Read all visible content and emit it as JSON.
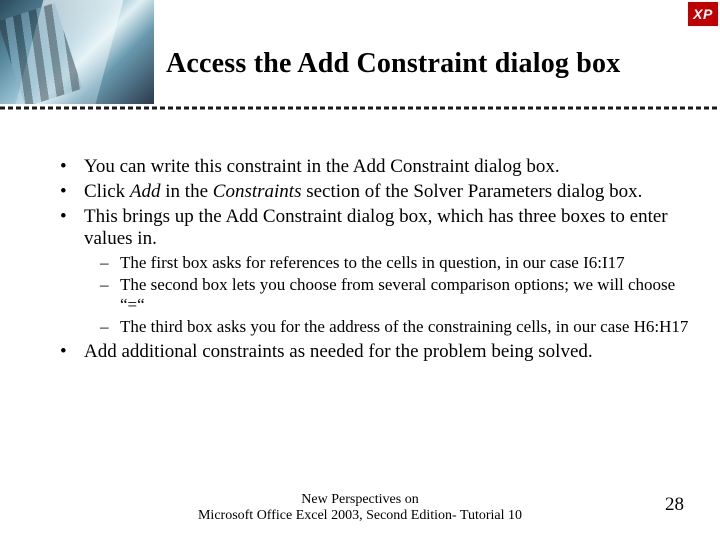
{
  "badge": "XP",
  "title": "Access the Add Constraint dialog box",
  "bullets": {
    "b1_a": "You can write this constraint in the Add Constraint dialog box.",
    "b2_a": "Click ",
    "b2_i": "Add",
    "b2_b": " in the ",
    "b2_j": "Constraints",
    "b2_c": " section of the Solver Parameters dialog box.",
    "b3_a": "This brings up the Add Constraint dialog box, which has three boxes to enter values in.",
    "s1": "The first box asks for references to the cells in question, in our case I6:I17",
    "s2": "The second box lets you choose from several comparison options; we will choose “=“",
    "s3": "The third box asks you for the address of the constraining cells, in our case H6:H17",
    "b4_a": "Add additional constraints as needed for the problem being solved."
  },
  "footer": {
    "line1": "New Perspectives on",
    "line2": "Microsoft Office Excel 2003, Second Edition- Tutorial 10"
  },
  "page": "28"
}
